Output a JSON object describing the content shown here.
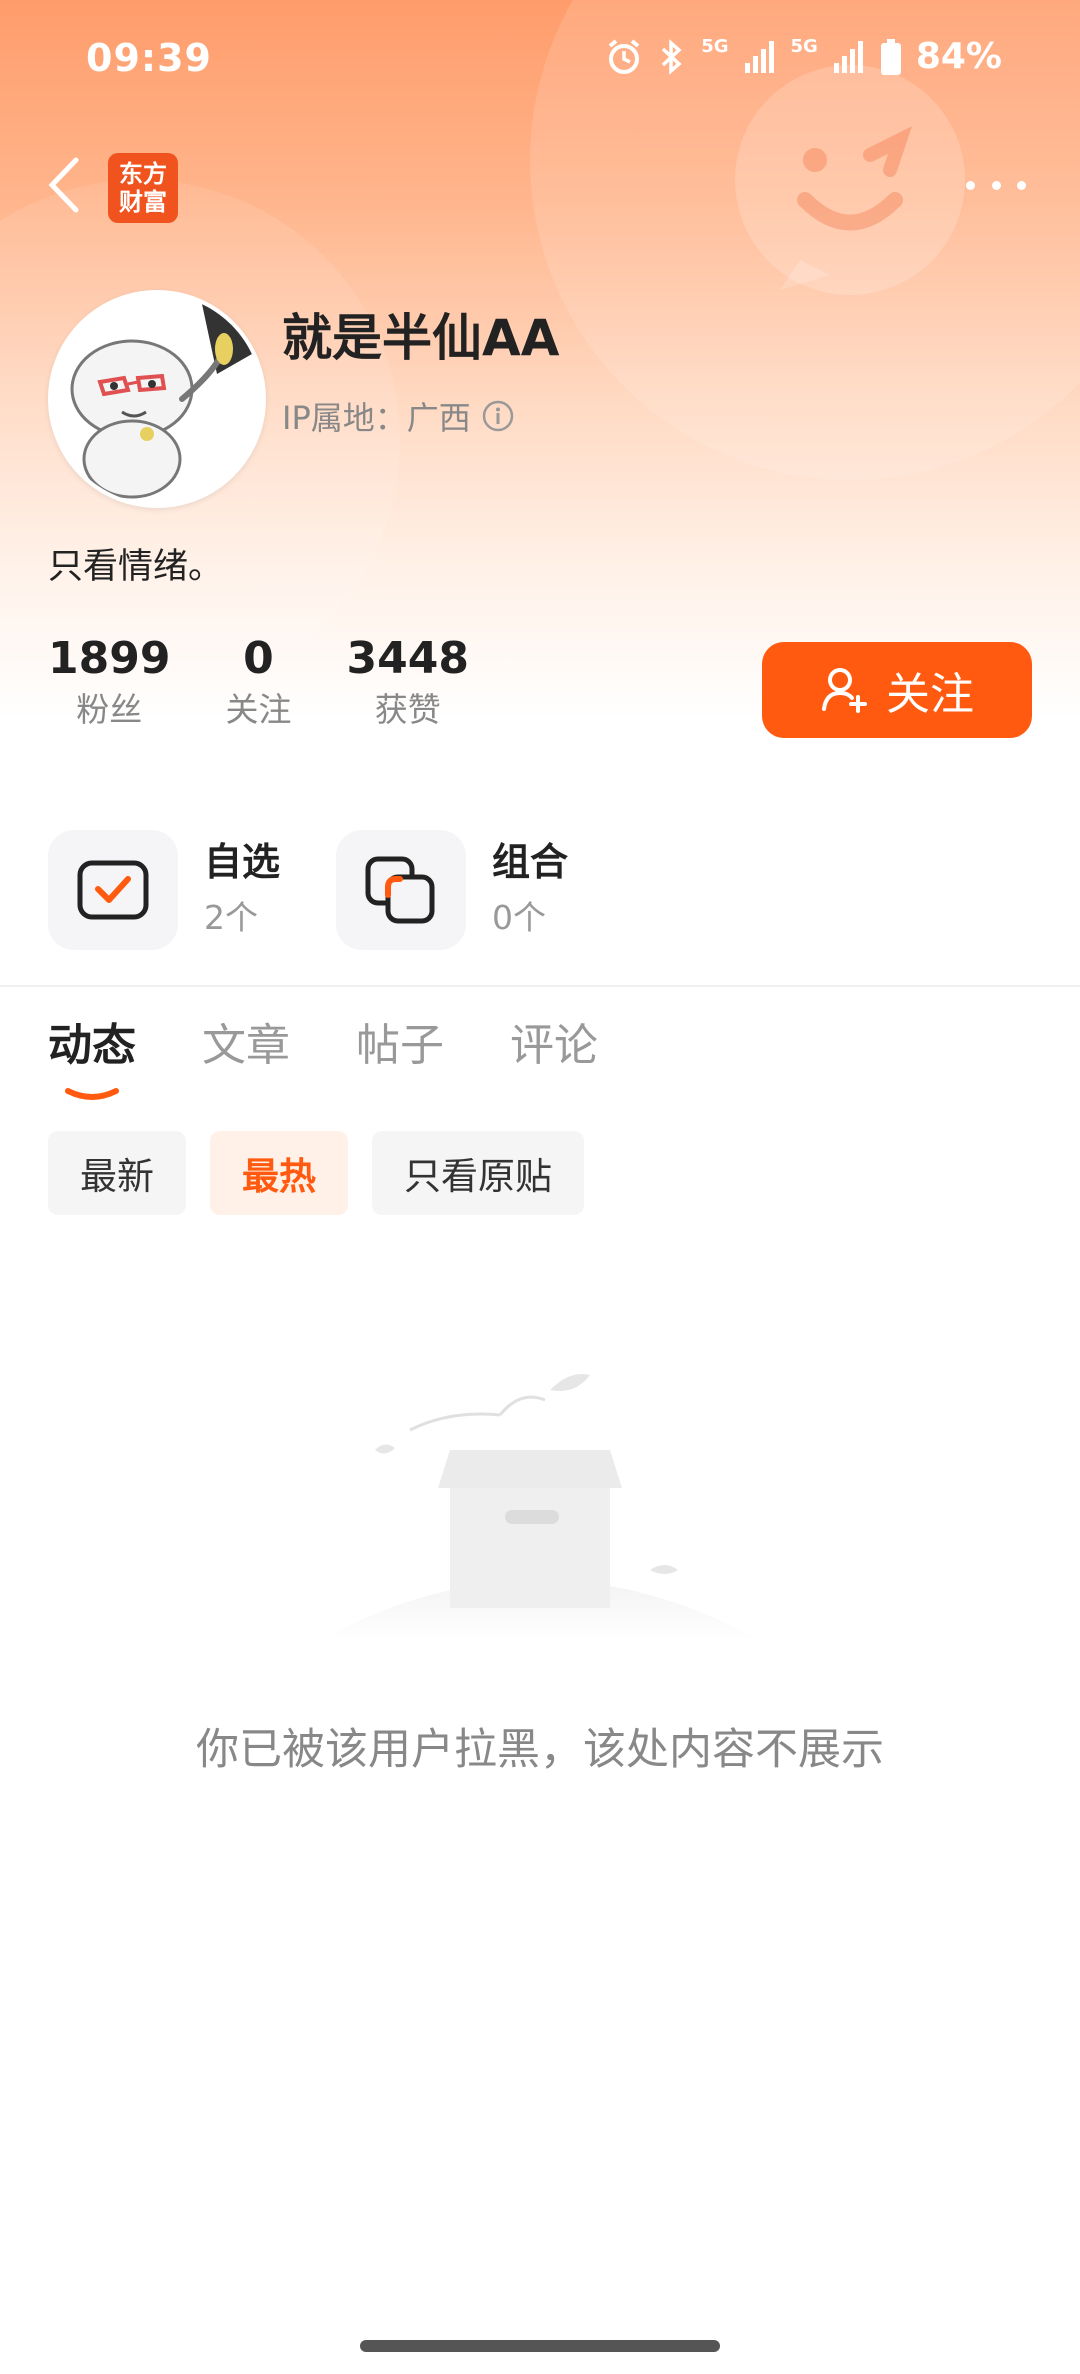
{
  "status_bar": {
    "time": "09:39",
    "battery": "84%",
    "network_1": "5G",
    "network_2": "5G"
  },
  "nav": {
    "app_logo_line1": "东方",
    "app_logo_line2": "财富"
  },
  "profile": {
    "username": "就是半仙AA",
    "ip_location": "IP属地：广西",
    "bio": "只看情绪。"
  },
  "stats": [
    {
      "value": "1899",
      "label": "粉丝"
    },
    {
      "value": "0",
      "label": "关注"
    },
    {
      "value": "3448",
      "label": "获赞"
    }
  ],
  "follow_button_label": "关注",
  "quick_links": [
    {
      "title": "自选",
      "count": "2个",
      "icon": "watchlist-check-icon"
    },
    {
      "title": "组合",
      "count": "0个",
      "icon": "portfolio-icon"
    }
  ],
  "tabs": [
    {
      "label": "动态",
      "active": true
    },
    {
      "label": "文章",
      "active": false
    },
    {
      "label": "帖子",
      "active": false
    },
    {
      "label": "评论",
      "active": false
    }
  ],
  "filters": [
    {
      "label": "最新",
      "active": false
    },
    {
      "label": "最热",
      "active": true
    },
    {
      "label": "只看原贴",
      "active": false
    }
  ],
  "empty_message": "你已被该用户拉黑，该处内容不展示",
  "colors": {
    "accent": "#ff5a0f",
    "header_gradient_top": "#ff9c6b",
    "text_primary": "#222222",
    "text_secondary": "#888888"
  }
}
